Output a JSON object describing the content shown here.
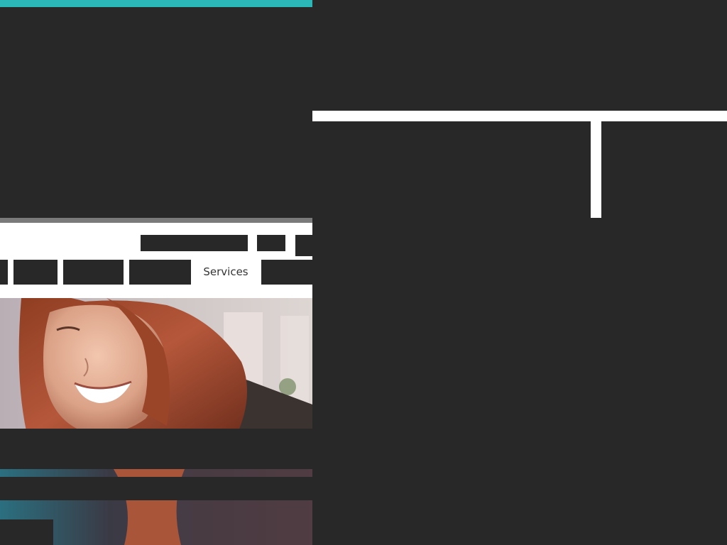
{
  "header": {
    "nav": {
      "items": [
        {
          "label": ""
        },
        {
          "label": ""
        },
        {
          "label": ""
        },
        {
          "label": ""
        },
        {
          "label": "Services"
        },
        {
          "label": ""
        }
      ]
    }
  },
  "hero": {
    "image": "smiling-woman-photo"
  },
  "colors": {
    "background": "#282828",
    "accent": "#2bb7b8",
    "header": "#ffffff",
    "rule": "#7a7a7a"
  }
}
